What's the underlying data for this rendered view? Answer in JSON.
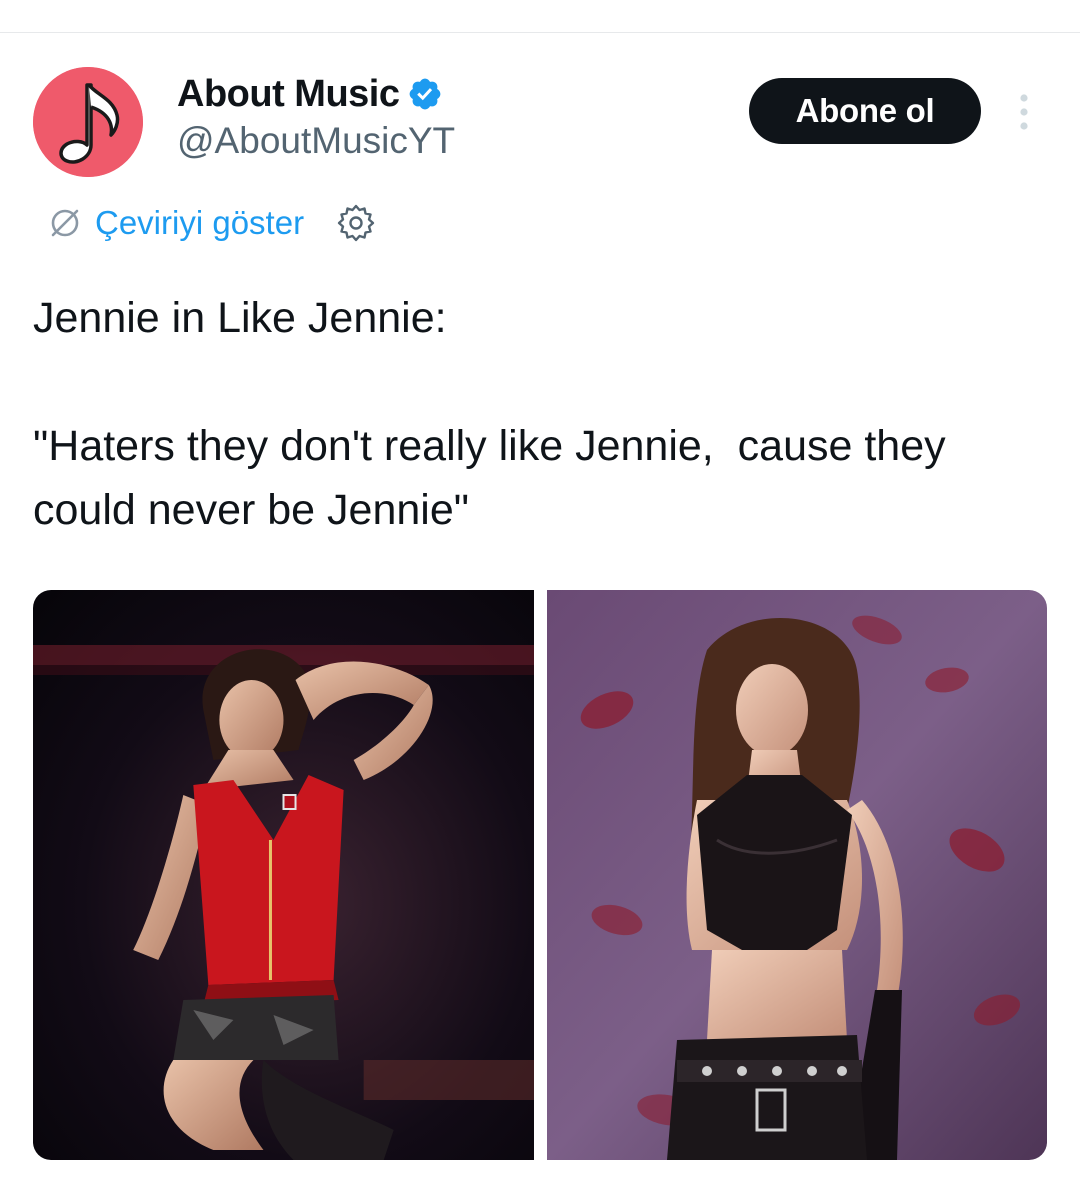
{
  "account": {
    "display_name": "About Music",
    "handle": "@AboutMusicYT",
    "verified": true,
    "avatar_icon": "music-note-icon",
    "avatar_color": "#ef5a6b"
  },
  "actions": {
    "follow_label": "Abone ol",
    "more_icon": "more-vertical-icon"
  },
  "translation": {
    "link_label": "Çeviriyi göster",
    "icon": "translate-globe-icon",
    "settings_icon": "gear-icon"
  },
  "tweet": {
    "line1": "Jennie in Like Jennie:",
    "line2": "\"Haters they don't really like Jennie,  cause they could never be Jennie\""
  },
  "media": {
    "photos": [
      {
        "icon": "photo-performer-red-corset"
      },
      {
        "icon": "photo-performer-black-halter"
      }
    ]
  },
  "colors": {
    "accent": "#1d9bf0",
    "text_primary": "#0f1419",
    "text_secondary": "#536471",
    "button_bg": "#0f1419"
  }
}
